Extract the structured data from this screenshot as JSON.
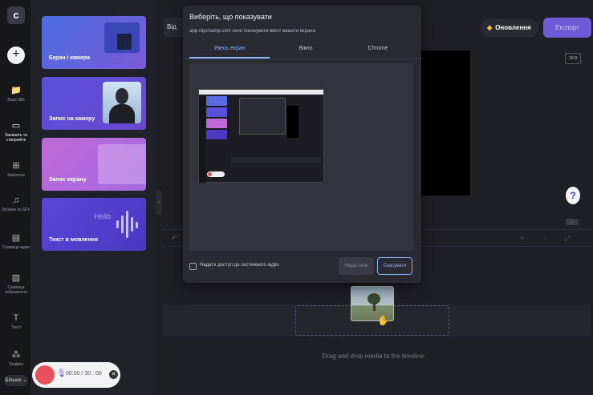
{
  "rail": {
    "logo": "c",
    "items": [
      {
        "label": "Ваші ЗМІ",
        "icon": "📁"
      },
      {
        "label": "Запишіть та створюйте",
        "icon": "▭"
      },
      {
        "label": "Шаблони",
        "icon": "⊞"
      },
      {
        "label": "Музика та SFX",
        "icon": "♫"
      },
      {
        "label": "Сховище відео",
        "icon": "▤"
      },
      {
        "label": "Сховище зображення",
        "icon": "▧"
      },
      {
        "label": "Текст",
        "icon": "T"
      },
      {
        "label": "Графіка",
        "icon": "⁂"
      }
    ],
    "more": "Більше ⌄"
  },
  "panel": {
    "cards": [
      {
        "label": "Екран і камера"
      },
      {
        "label": "Запис на камеру"
      },
      {
        "label": "Запис екрану"
      },
      {
        "label": "Текст в мовлення"
      }
    ],
    "hello": "Hello"
  },
  "recorder": {
    "time": "00:00 / 30 : 00",
    "mic_icon": "🎙",
    "close": "✕"
  },
  "topbar": {
    "title_stub": "Від",
    "upgrade": "Оновлення",
    "export": "Експорт"
  },
  "preview": {
    "ratio": "16:9",
    "help": "?"
  },
  "timeline": {
    "drop_text": "Drag and drop media to the timeline",
    "tools": "+ − ⤢",
    "undo": "↶"
  },
  "modal": {
    "title": "Виберіть, що показувати",
    "subtitle": "app.clipchamp.com хоче показувати вміст вашого екрана",
    "tabs": [
      "Увесь екран",
      "Вікно",
      "Chrome"
    ],
    "active_tab": 0,
    "audio_label": "Надати доступ до системного аудіо",
    "share": "Надіслати",
    "cancel": "Скасувати"
  },
  "colors": {
    "accent": "#6f5ad8",
    "tab_active": "#8ab4f8",
    "record": "#e8505b"
  }
}
